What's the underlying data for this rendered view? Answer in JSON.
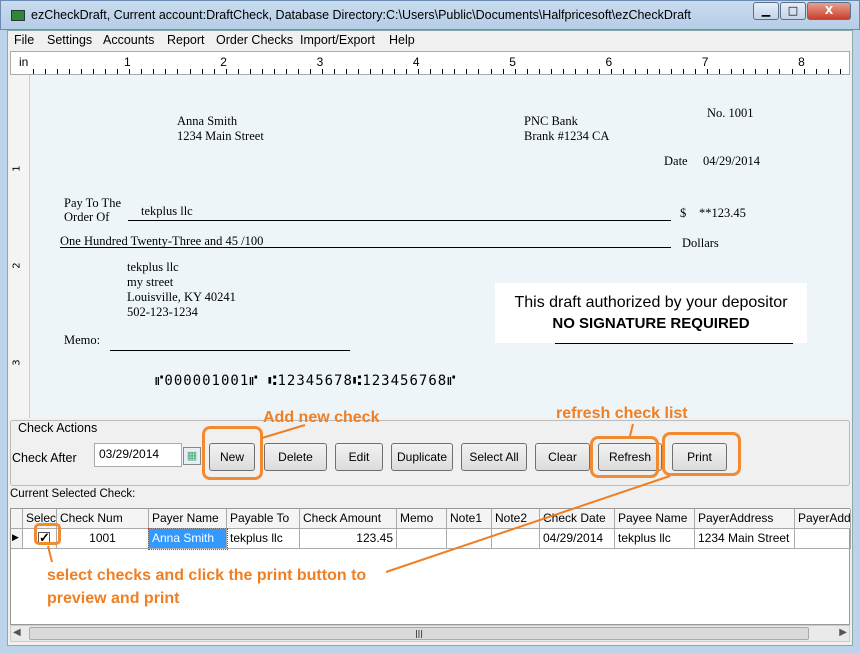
{
  "window": {
    "title": "ezCheckDraft, Current account:DraftCheck, Database Directory:C:\\Users\\Public\\Documents\\Halfpricesoft\\ezCheckDraft",
    "minimize": "▁",
    "maximize": "□",
    "close": "X"
  },
  "menu": [
    "File",
    "Settings",
    "Accounts",
    "Report",
    "Order Checks",
    "Import/Export",
    "Help"
  ],
  "ruler": {
    "unit": "in",
    "marks": [
      "1",
      "2",
      "3",
      "4",
      "5",
      "6",
      "7",
      "8"
    ],
    "vmarks": [
      "1",
      "2",
      "3"
    ]
  },
  "check": {
    "payer_name": "Anna Smith",
    "payer_address": "1234 Main Street",
    "bank_name": "PNC Bank",
    "bank_branch": "Brank #1234 CA",
    "check_no": "No. 1001",
    "date_label": "Date",
    "date": "04/29/2014",
    "pay_to_label_1": "Pay To The",
    "pay_to_label_2": "Order Of",
    "payee": "tekplus llc",
    "dollar_sign": "$",
    "amount": "**123.45",
    "amount_words": "One Hundred  Twenty-Three  and 45 /100",
    "dollars_label": "Dollars",
    "payee_address": [
      "tekplus llc",
      "my street",
      "Louisville, KY 40241",
      "502-123-1234"
    ],
    "memo_label": "Memo:",
    "auth_line1": "This draft authorized by your depositor",
    "auth_line2": "NO SIGNATURE REQUIRED",
    "micr": "⑈000001001⑈ ⑆12345678⑆123456768⑈"
  },
  "actions": {
    "group_label": "Check Actions",
    "check_after_label": "Check After",
    "check_after_value": "03/29/2014",
    "buttons": [
      "New",
      "Delete",
      "Edit",
      "Duplicate",
      "Select All",
      "Clear",
      "Refresh",
      "Print"
    ]
  },
  "annotations": {
    "new": "Add new check",
    "refresh": "refresh check list",
    "select": "select checks and click the print button to",
    "select2": "preview and print"
  },
  "grid": {
    "label": "Current Selected Check:",
    "columns": [
      "Select",
      "Check Num",
      "Payer Name",
      "Payable To",
      "Check Amount",
      "Memo",
      "Note1",
      "Note2",
      "Check Date",
      "Payee Name",
      "PayerAddress",
      "PayerAdd"
    ],
    "rows": [
      {
        "selected": true,
        "cells": [
          "",
          "1001",
          "Anna Smith",
          "tekplus llc",
          "123.45",
          "",
          "",
          "",
          "04/29/2014",
          "tekplus llc",
          "1234 Main Street",
          ""
        ]
      }
    ]
  },
  "colors": {
    "accent_annotation": "#f07e22",
    "selection": "#3399ff",
    "check_bg": "#eef5f8"
  }
}
